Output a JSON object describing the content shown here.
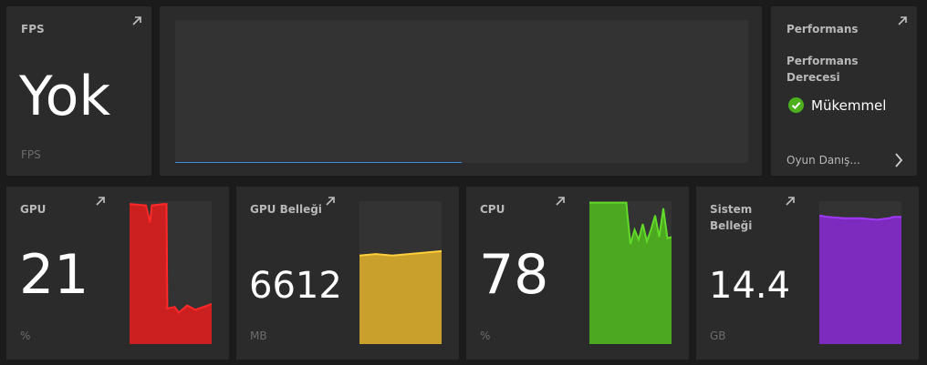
{
  "fps": {
    "title": "FPS",
    "value": "Yok",
    "unit": "FPS",
    "graph_progress": 0.5
  },
  "performance": {
    "title": "Performans",
    "rating_label": "Performans Derecesi",
    "rating_value": "Mükemmel",
    "advisor_link": "Oyun Danış...",
    "status_color": "#4caf1e"
  },
  "metrics": [
    {
      "title": "GPU",
      "value": "21",
      "unit": "%",
      "color": "#cc1f1f",
      "icon": "expand-icon"
    },
    {
      "title": "GPU Belleği",
      "value": "6612",
      "unit": "MB",
      "color": "#c9a02c",
      "icon": "expand-icon"
    },
    {
      "title": "CPU",
      "value": "78",
      "unit": "%",
      "color": "#4ca820",
      "icon": "expand-icon"
    },
    {
      "title": "Sistem Belleği",
      "value": "14.4",
      "unit": "GB",
      "color": "#7d2bbf",
      "icon": "expand-icon"
    }
  ]
}
